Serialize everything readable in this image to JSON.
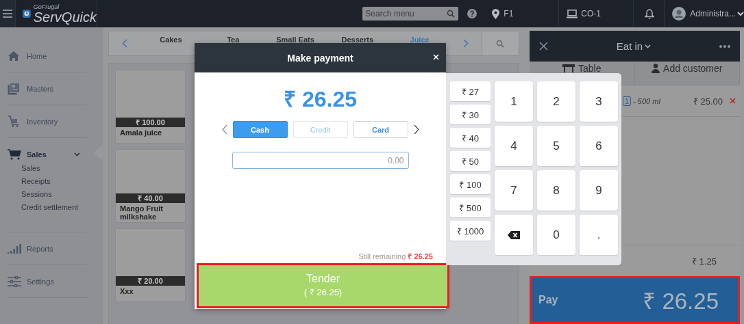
{
  "top_bar": {
    "brand_small": "GoFrugal",
    "brand": "ServQuick",
    "search": {
      "placeholder": "Search menu"
    },
    "location": "F1",
    "counter": "CO-1",
    "user": "Administra..."
  },
  "sidebar": {
    "items": [
      {
        "label": "Home",
        "selected": false
      },
      {
        "label": "Masters",
        "selected": false
      },
      {
        "label": "Inventory",
        "selected": false
      },
      {
        "label": "Sales",
        "selected": true,
        "expanded": true,
        "children": [
          {
            "label": "Sales"
          },
          {
            "label": "Receipts"
          },
          {
            "label": "Sessions"
          },
          {
            "label": "Credit settlement"
          }
        ]
      },
      {
        "label": "Reports",
        "selected": false
      },
      {
        "label": "Settings",
        "selected": false
      }
    ]
  },
  "categories": [
    {
      "label": "Cakes",
      "selected": false
    },
    {
      "label": "Tea",
      "selected": false
    },
    {
      "label": "Small Eats",
      "selected": false
    },
    {
      "label": "Desserts",
      "selected": false
    },
    {
      "label": "Juice",
      "selected": true
    }
  ],
  "products": [
    {
      "name": "Amala juice",
      "price": "₹ 100.00"
    },
    {
      "name": "Mango Fruit milkshake",
      "price": "₹ 40.00"
    },
    {
      "name": "Xxx",
      "price": "₹ 20.00"
    }
  ],
  "order_panel": {
    "mode": "Eat in",
    "tabs": [
      {
        "label": "Table"
      },
      {
        "label": "Add customer"
      }
    ],
    "lines": [
      {
        "quantity": "1",
        "variant": "- 500 ml",
        "amount": "₹ 25.00"
      }
    ],
    "total_amount": "₹ 1.25",
    "pay": {
      "label": "Pay",
      "amount": "₹ 26.25",
      "highlighted": true
    }
  },
  "payment_dialog": {
    "title": "Make payment",
    "amount": "₹ 26.25",
    "methods": [
      {
        "label": "Cash",
        "selected": true,
        "disabled": false
      },
      {
        "label": "Credit",
        "selected": false,
        "disabled": true
      },
      {
        "label": "Card",
        "selected": false,
        "disabled": false
      }
    ],
    "tendered": "0.00",
    "remaining_label": "Still remaining",
    "remaining_amount": "₹ 26.25",
    "tender": {
      "label": "Tender",
      "amount": "( ₹ 26.25)",
      "highlighted": true
    }
  },
  "keypad": {
    "quick_amounts": [
      "₹ 27",
      "₹ 30",
      "₹ 40",
      "₹ 50",
      "₹ 100",
      "₹ 500",
      "₹ 1000"
    ],
    "keys": [
      {
        "kind": "digit",
        "label": "1"
      },
      {
        "kind": "digit",
        "label": "2"
      },
      {
        "kind": "digit",
        "label": "3"
      },
      {
        "kind": "digit",
        "label": "4"
      },
      {
        "kind": "digit",
        "label": "5"
      },
      {
        "kind": "digit",
        "label": "6"
      },
      {
        "kind": "digit",
        "label": "7"
      },
      {
        "kind": "digit",
        "label": "8"
      },
      {
        "kind": "digit",
        "label": "9"
      },
      {
        "kind": "backspace"
      },
      {
        "kind": "digit",
        "label": "0"
      },
      {
        "kind": "digit",
        "label": "."
      }
    ]
  }
}
